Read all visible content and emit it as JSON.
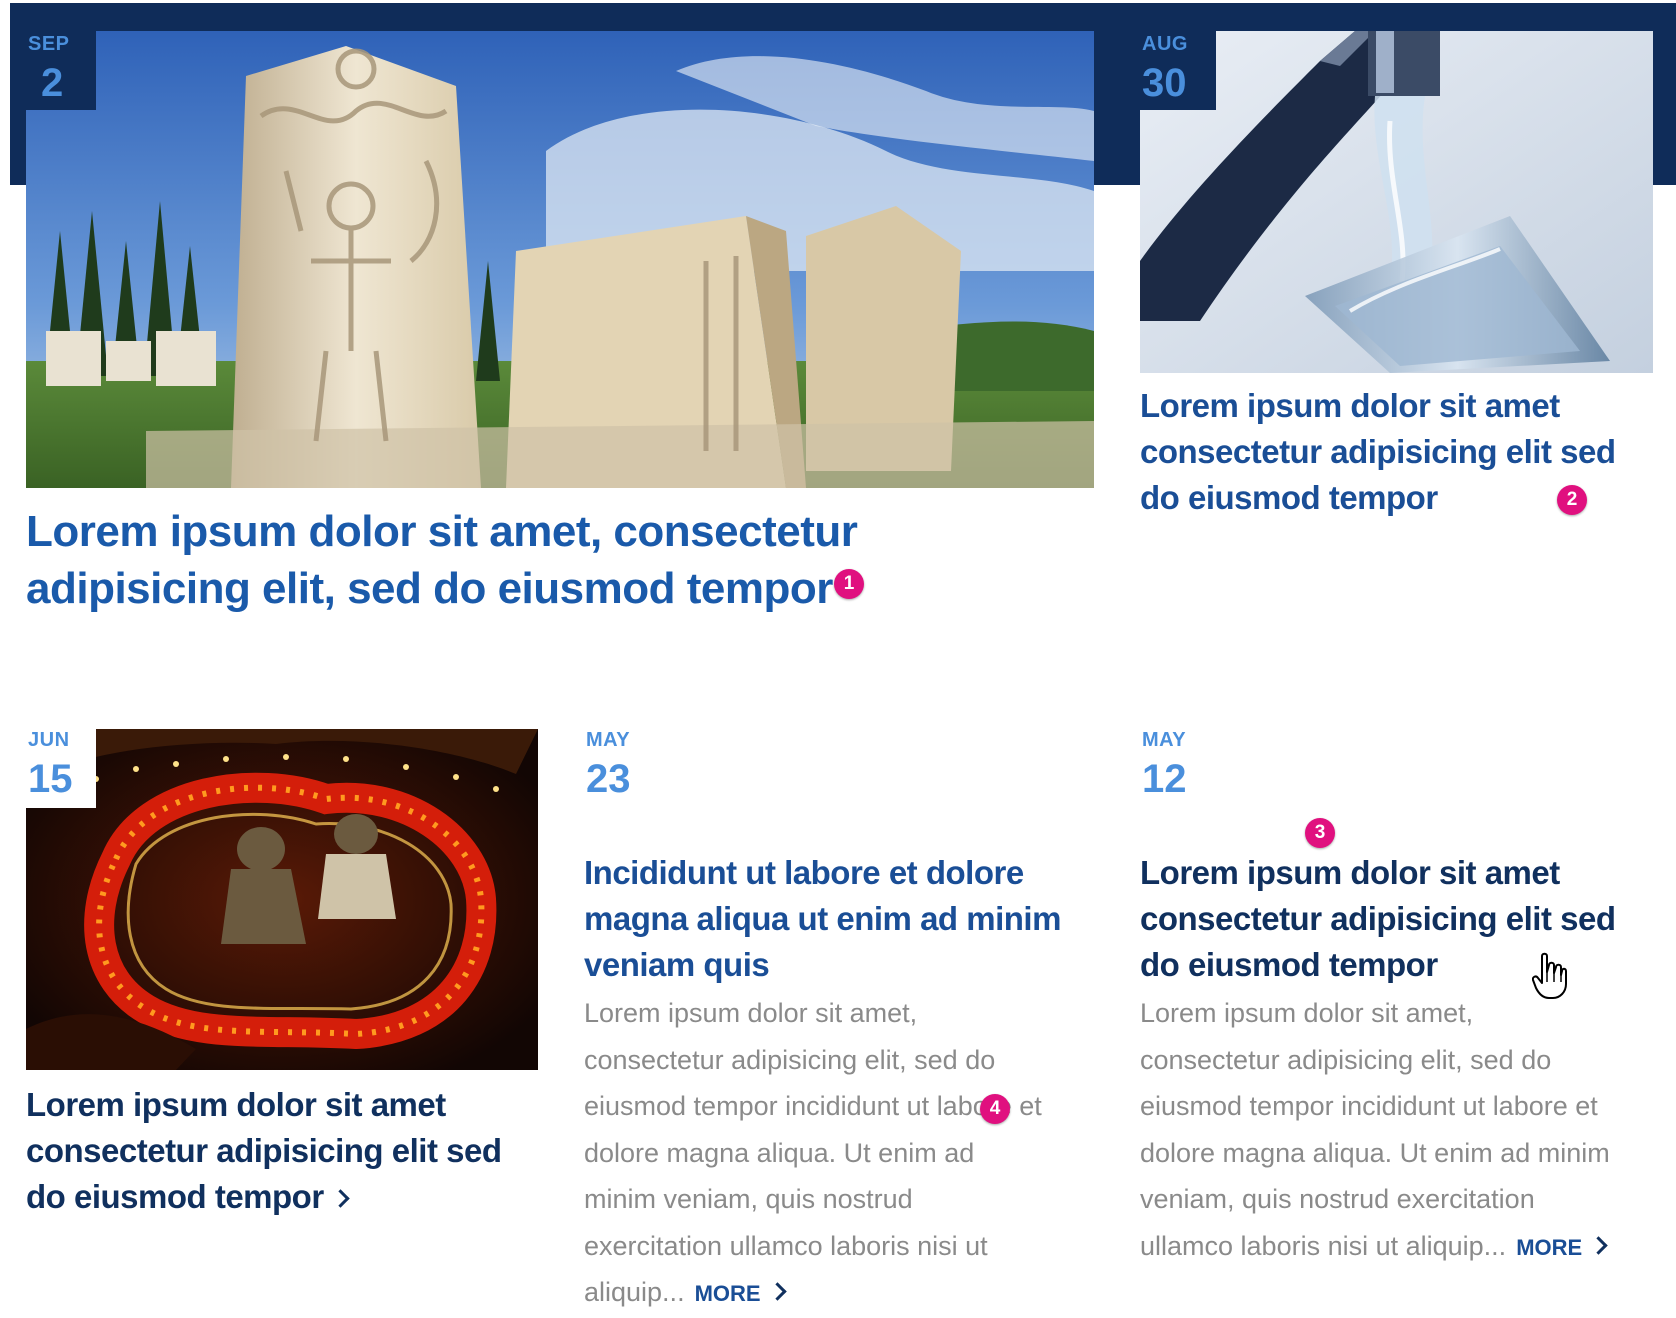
{
  "articles": [
    {
      "month": "SEP",
      "day": "2",
      "title": "Lorem ipsum dolor sit amet, consectetur adipisicing elit, sed do eiusmod tempor",
      "badge": "1"
    },
    {
      "month": "AUG",
      "day": "30",
      "title": "Lorem ipsum dolor sit amet consectetur adipisicing elit sed do eiusmod tempor",
      "badge": "2"
    },
    {
      "month": "JUN",
      "day": "15",
      "title": "Lorem ipsum dolor sit amet consectetur adipisicing elit sed do eiusmod tempor"
    },
    {
      "month": "MAY",
      "day": "23",
      "title": "Incididunt ut labore et dolore magna aliqua ut enim ad minim veniam quis",
      "excerpt": "Lorem ipsum dolor sit amet, consectetur adipisicing elit, sed do eiusmod tempor incididunt ut labore et dolore magna aliqua. Ut enim ad minim veniam, quis nostrud exercitation ullamco laboris nisi ut aliquip...",
      "more_label": "MORE",
      "badge": "4"
    },
    {
      "month": "MAY",
      "day": "12",
      "title": "Lorem ipsum dolor sit amet consectetur adipisicing elit sed do eiusmod tempor",
      "excerpt": "Lorem ipsum dolor sit amet, consectetur adipisicing elit, sed do eiusmod tempor incididunt ut labore et dolore magna aliqua. Ut enim ad minim veniam, quis nostrud exercitation ullamco laboris nisi ut aliquip...",
      "more_label": "MORE",
      "badge": "3"
    }
  ],
  "colors": {
    "navy": "#0f2c59",
    "date_blue": "#4a8fdc",
    "title_blue": "#1a4e96",
    "badge_pink": "#e0107f",
    "body_gray": "#8a8a8a"
  },
  "icons": {
    "more": "chevron-right-icon",
    "cursor": "hand-pointer-icon"
  }
}
